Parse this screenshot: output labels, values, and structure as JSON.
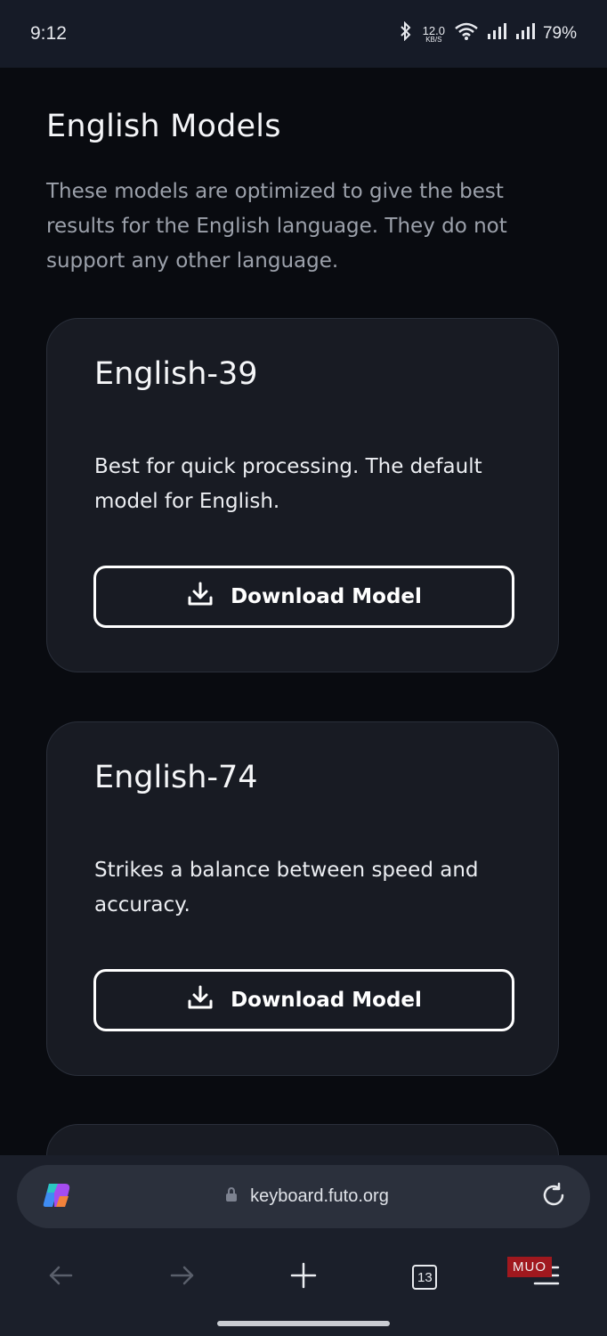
{
  "status_bar": {
    "time": "9:12",
    "net_speed_value": "12.0",
    "net_speed_unit": "KB/S",
    "battery": "79%",
    "icons": [
      "bluetooth-icon",
      "wifi-icon",
      "signal-icon",
      "signal-icon"
    ]
  },
  "page": {
    "title": "English Models",
    "description": "These models are optimized to give the best results for the English language. They do not support any other language."
  },
  "models": [
    {
      "name": "English-39",
      "description": "Best for quick processing. The default model for English.",
      "button_label": "Download Model"
    },
    {
      "name": "English-74",
      "description": "Strikes a balance between speed and accuracy.",
      "button_label": "Download Model"
    }
  ],
  "browser": {
    "url": "keyboard.futo.org",
    "tab_count": "13",
    "watermark": "MUO"
  },
  "colors": {
    "background": "#090b10",
    "status_bar": "#161b27",
    "card": "#181b23",
    "card_border": "#2a2f3a",
    "url_bar": "#2b303c",
    "watermark": "#a0181e"
  }
}
